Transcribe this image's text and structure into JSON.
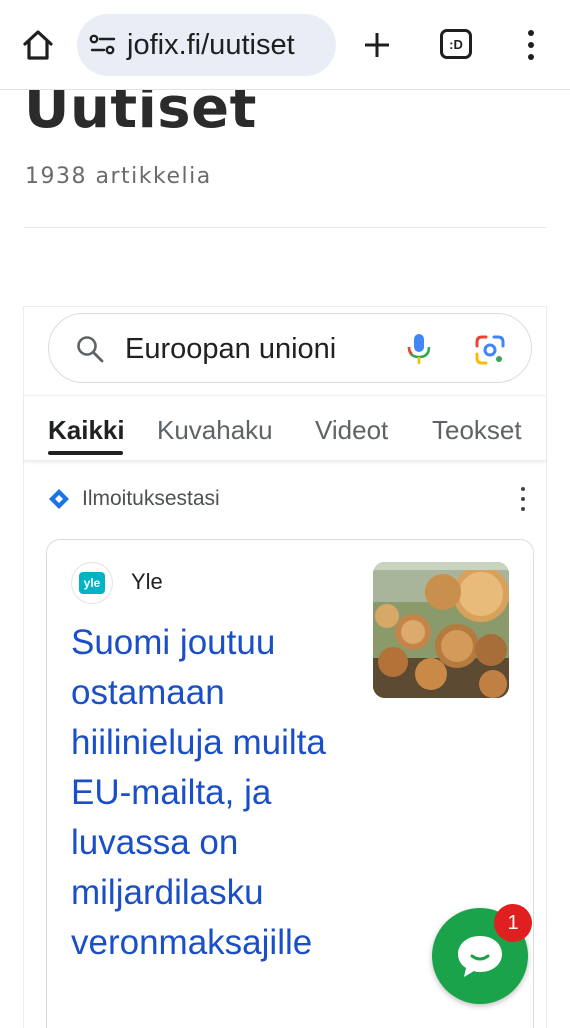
{
  "browser": {
    "url": "jofix.fi/uutiset",
    "tab_count_label": ":D"
  },
  "page": {
    "title": "Uutiset",
    "article_count": "1938 artikkelia"
  },
  "google": {
    "search_query": "Euroopan unioni",
    "tabs": [
      {
        "label": "Kaikki",
        "active": true
      },
      {
        "label": "Kuvahaku",
        "active": false
      },
      {
        "label": "Videot",
        "active": false
      },
      {
        "label": "Teokset",
        "active": false
      }
    ],
    "section_label": "Ilmoituksestasi",
    "news_card": {
      "source_logo_text": "yle",
      "source": "Yle",
      "title": "Suomi joutuu ostamaan hiilinieluja muilta EU-mailta, ja luvassa on miljardilasku veronmaksajille"
    }
  },
  "chat": {
    "badge_count": "1"
  },
  "colors": {
    "link_blue": "#1a4fc7",
    "chat_green": "#1aa34a",
    "badge_red": "#e02020",
    "url_pill_bg": "#e9eef6"
  }
}
